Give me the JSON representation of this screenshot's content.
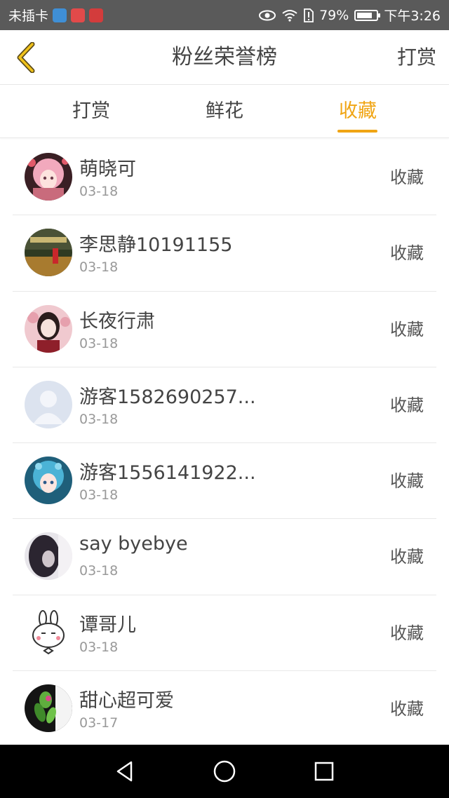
{
  "status_bar": {
    "carrier": "未插卡",
    "battery_percent": "79%",
    "battery_level": 0.79,
    "time": "下午3:26",
    "left_icons": [
      "browser-app-icon",
      "mall-app-icon",
      "book-app-icon"
    ],
    "right_icons": [
      "eye-icon",
      "wifi-icon",
      "sim-alert-icon",
      "battery-icon"
    ]
  },
  "header": {
    "back_icon": "chevron-left-icon",
    "title": "粉丝荣誉榜",
    "action_label": "打赏"
  },
  "tabs": [
    {
      "label": "打赏",
      "active": false
    },
    {
      "label": "鲜花",
      "active": false
    },
    {
      "label": "收藏",
      "active": true
    }
  ],
  "fans": [
    {
      "name": "萌晓可",
      "date": "03-18",
      "action": "收藏",
      "avatar": "anime-girl-pink-avatar"
    },
    {
      "name": "李思静10191155",
      "date": "03-18",
      "action": "收藏",
      "avatar": "photo-landscape-avatar"
    },
    {
      "name": "长夜行肃",
      "date": "03-18",
      "action": "收藏",
      "avatar": "photo-girl-avatar"
    },
    {
      "name": "游客1582690257...",
      "date": "03-18",
      "action": "收藏",
      "avatar": "default-user-avatar"
    },
    {
      "name": "游客1556141922...",
      "date": "03-18",
      "action": "收藏",
      "avatar": "anime-girl-blue-avatar"
    },
    {
      "name": "say byebye",
      "date": "03-18",
      "action": "收藏",
      "avatar": "dark-portrait-avatar"
    },
    {
      "name": "谭哥儿",
      "date": "03-18",
      "action": "收藏",
      "avatar": "bunny-sticker-avatar"
    },
    {
      "name": "甜心超可爱",
      "date": "03-17",
      "action": "收藏",
      "avatar": "green-flower-avatar"
    }
  ],
  "colors": {
    "accent": "#f0a514",
    "status_bar_bg": "#5a5a5a",
    "nav_bar_bg": "#000000"
  },
  "nav_bar": [
    "back-triangle-icon",
    "home-circle-icon",
    "recents-square-icon"
  ]
}
